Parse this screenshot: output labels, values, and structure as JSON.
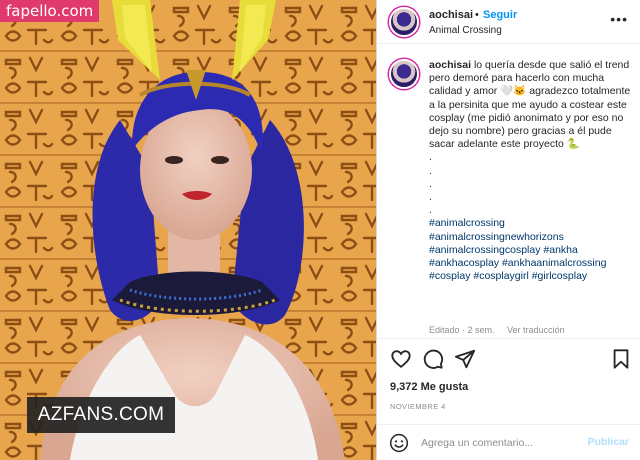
{
  "photo": {
    "site_tag": "fapello.com",
    "watermark": "AZFANS.COM"
  },
  "header": {
    "username": "aochisai",
    "separator": "•",
    "follow_label": "Seguir",
    "location": "Animal Crossing",
    "more_icon": "more-options-icon"
  },
  "caption": {
    "username": "aochisai",
    "text": "lo quería desde que salió el trend pero demoré para hacerlo con mucha calidad y amor 🤍🐱 agradezco totalmente a la persinita que me ayudo a costear este cosplay (me pidió anonimato y por eso no dejo su nombre) pero gracias a él pude sacar adelante este proyecto 🐍",
    "dots": ".\n.\n.\n.\n.",
    "hashtags": "#animalcrossing\n#animalcrossingnewhorizons\n#animalcrossingcosplay #ankha\n#ankhacosplay #ankhaanimalcrossing\n#cosplay #cosplaygirl #girlcosplay"
  },
  "meta": {
    "edited": "Editado · 2 sem.",
    "translate": "Ver traducción"
  },
  "actions": {
    "like_icon": "heart-icon",
    "comment_icon": "comment-icon",
    "share_icon": "share-icon",
    "save_icon": "bookmark-icon"
  },
  "likes": "9,372 Me gusta",
  "date": "NOVIEMBRE 4",
  "comment": {
    "placeholder": "Agrega un comentario...",
    "post_label": "Publicar",
    "emoji_icon": "emoji-icon"
  },
  "colors": {
    "link_blue": "#0095f6",
    "hashtag_blue": "#00376b",
    "muted_gray": "#8e8e8e",
    "publish_disabled": "#b2dffc",
    "photo_background": "#e8a24a",
    "site_tag_pink": "#e0396e"
  }
}
